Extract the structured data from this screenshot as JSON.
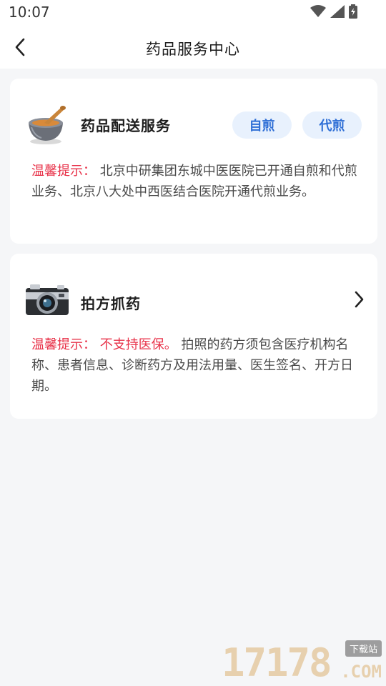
{
  "status_bar": {
    "time": "10:07",
    "icons": [
      "wifi-icon",
      "signal-icon",
      "battery-charging-icon"
    ]
  },
  "nav": {
    "title": "药品服务中心",
    "back_icon": "chevron-left-icon"
  },
  "cards": [
    {
      "icon": "mortar-pestle-icon",
      "title": "药品配送服务",
      "buttons": [
        "自煎",
        "代煎"
      ],
      "notice_label": "温馨提示：",
      "notice_text": "北京中研集团东城中医医院已开通自煎和代煎业务、北京八大处中西医结合医院开通代煎业务。"
    },
    {
      "icon": "camera-icon",
      "title": "拍方抓药",
      "chevron_icon": "chevron-right-icon",
      "notice_label": "温馨提示：",
      "notice_warn": "不支持医保。",
      "notice_text": "拍照的药方须包含医疗机构名称、患者信息、诊断药方及用法用量、医生签名、开方日期。"
    }
  ],
  "watermark": {
    "digits": "17178",
    "tag": "下载站",
    "domain": ".COM"
  },
  "colors": {
    "accent_blue": "#2f6fd6",
    "pill_bg": "#e8f1fd",
    "warning_red": "#e8334a",
    "page_bg": "#f5f6f8"
  }
}
